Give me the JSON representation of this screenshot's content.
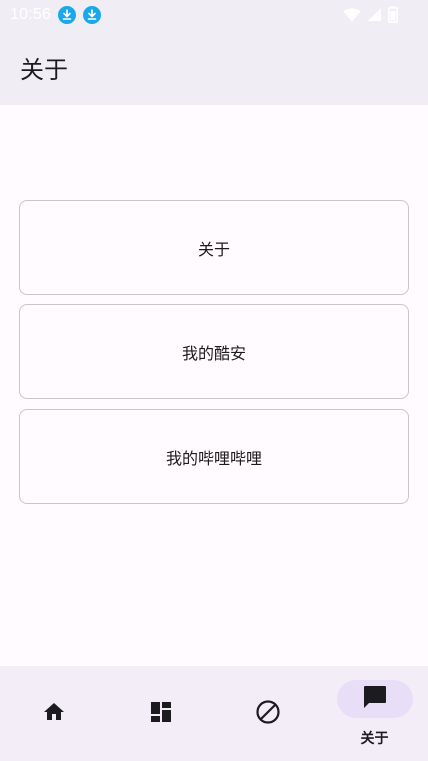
{
  "status_bar": {
    "time": "10:56",
    "notifications": [
      "download-icon",
      "download-icon"
    ],
    "indicators": [
      "wifi-icon",
      "cell-signal-icon",
      "battery-icon"
    ]
  },
  "app_bar": {
    "title": "关于"
  },
  "buttons": [
    {
      "label": "关于"
    },
    {
      "label": "我的酷安"
    },
    {
      "label": "我的哔哩哔哩"
    }
  ],
  "bottom_nav": {
    "items": [
      {
        "icon": "home-icon",
        "label": ""
      },
      {
        "icon": "dashboard-icon",
        "label": ""
      },
      {
        "icon": "block-icon",
        "label": ""
      },
      {
        "icon": "chat-icon",
        "label": "关于",
        "active": true
      }
    ]
  },
  "colors": {
    "surface": "#fffbfe",
    "app_bar": "#f1edf5",
    "nav_bar": "#f3edf7",
    "active_pill": "#e8def8",
    "outline": "#c9c5ca",
    "on_surface": "#1c1b1f",
    "download_badge": "#1aa7ec"
  }
}
